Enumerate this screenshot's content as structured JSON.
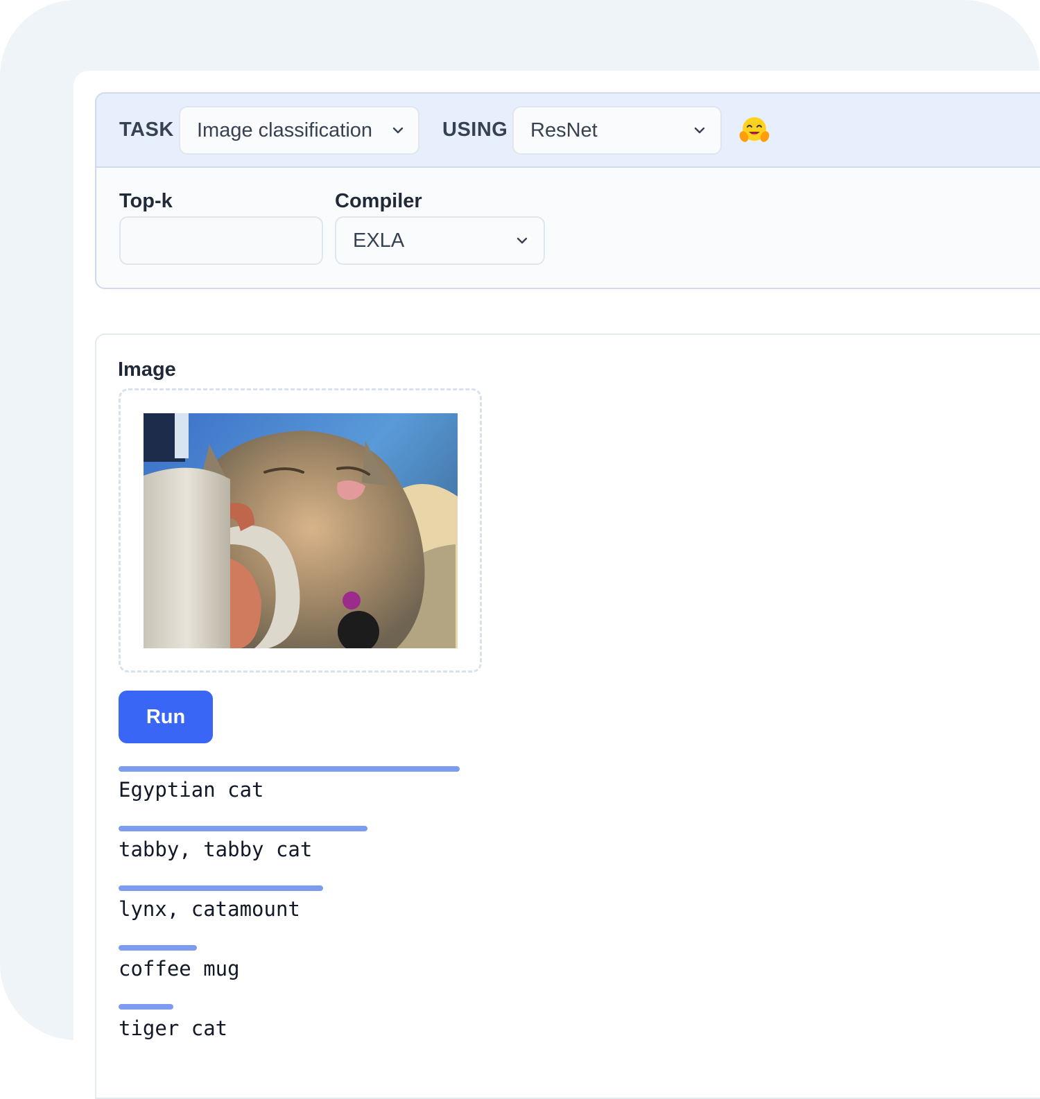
{
  "header": {
    "task_label": "TASK",
    "task_value": "Image classification",
    "using_label": "USING",
    "using_value": "ResNet",
    "logo_icon": "hugging-face-icon"
  },
  "options": {
    "topk_label": "Top-k",
    "topk_value": "",
    "compiler_label": "Compiler",
    "compiler_value": "EXLA"
  },
  "input": {
    "image_label": "Image",
    "run_label": "Run"
  },
  "results": [
    {
      "label": "Egyptian cat",
      "score": 1.0
    },
    {
      "label": "tabby, tabby cat",
      "score": 0.73
    },
    {
      "label": "lynx, catamount",
      "score": 0.6
    },
    {
      "label": "coffee mug",
      "score": 0.23
    },
    {
      "label": "tiger cat",
      "score": 0.16
    }
  ],
  "colors": {
    "accent": "#3a66f5",
    "bar": "#7e9bf2",
    "header_bg": "#e8effc"
  }
}
